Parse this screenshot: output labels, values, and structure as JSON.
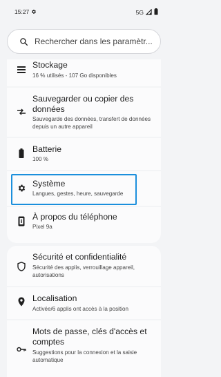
{
  "status_bar": {
    "time": "15:27",
    "network": "5G"
  },
  "search": {
    "placeholder": "Rechercher dans les paramètr..."
  },
  "settings_items": [
    {
      "title": "Stockage",
      "subtitle": "16 % utilisés - 107 Go disponibles",
      "icon": "storage-icon"
    },
    {
      "title": "Sauvegarder ou copier des données",
      "subtitle": "Sauvegarde des données, transfert de données depuis un autre appareil",
      "icon": "transfer-arrows-icon"
    },
    {
      "title": "Batterie",
      "subtitle": "100 %",
      "icon": "battery-icon"
    },
    {
      "title": "Système",
      "subtitle": "Langues, gestes, heure, sauvegarde",
      "icon": "gear-icon"
    },
    {
      "title": "À propos du téléphone",
      "subtitle": "Pixel 9a",
      "icon": "phone-icon"
    },
    {
      "title": "Sécurité et confidentialité",
      "subtitle": "Sécurité des applis, verrouillage appareil, autorisations",
      "icon": "shield-icon"
    },
    {
      "title": "Localisation",
      "subtitle": "Activée/6 applis ont accès à la position",
      "icon": "location-pin-icon"
    },
    {
      "title": "Mots de passe, clés d'accès et comptes",
      "subtitle": "Suggestions pour la connexion et la saisie automatique",
      "icon": "key-icon"
    }
  ],
  "colors": {
    "highlight": "#1b8fdc",
    "background": "#f3f4f6",
    "card": "#fbfbfc"
  }
}
